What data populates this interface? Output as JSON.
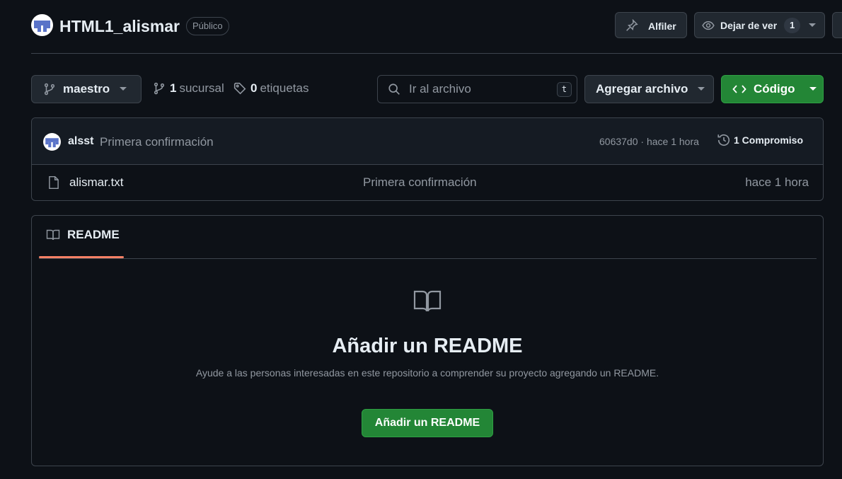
{
  "repo": {
    "name": "HTML1_alismar",
    "visibility": "Público"
  },
  "header": {
    "pin_label": "Alfiler",
    "watch_label": "Dejar de ver",
    "watch_count": "1"
  },
  "toolbar": {
    "branch_name": "maestro",
    "branches_count": "1",
    "branches_label": "sucursal",
    "tags_count": "0",
    "tags_label": "etiquetas",
    "search_placeholder": "Ir al archivo",
    "search_shortcut": "t",
    "add_file_label": "Agregar archivo",
    "code_label": "Código"
  },
  "commit": {
    "author": "alsst",
    "message": "Primera confirmación",
    "meta": "60637d0 · hace 1 hora",
    "history_label": "1 Compromiso"
  },
  "files": [
    {
      "name": "alismar.txt",
      "message": "Primera confirmación",
      "time": "hace 1 hora"
    }
  ],
  "readme": {
    "tab_label": "README",
    "empty_title": "Añadir un README",
    "empty_description": "Ayude a las personas interesadas en este repositorio a comprender su proyecto agregando un README.",
    "button_label": "Añadir un README"
  },
  "icons": {
    "pin": "pin-icon",
    "eye": "eye-icon",
    "branch": "git-branch-icon",
    "tag": "tag-icon",
    "search": "search-icon",
    "code": "code-icon",
    "history": "history-icon",
    "file": "file-icon",
    "book": "book-icon"
  },
  "colors": {
    "background": "#0d1117",
    "border": "#3d444d",
    "primary_button": "#238636",
    "tab_accent": "#f78166"
  }
}
